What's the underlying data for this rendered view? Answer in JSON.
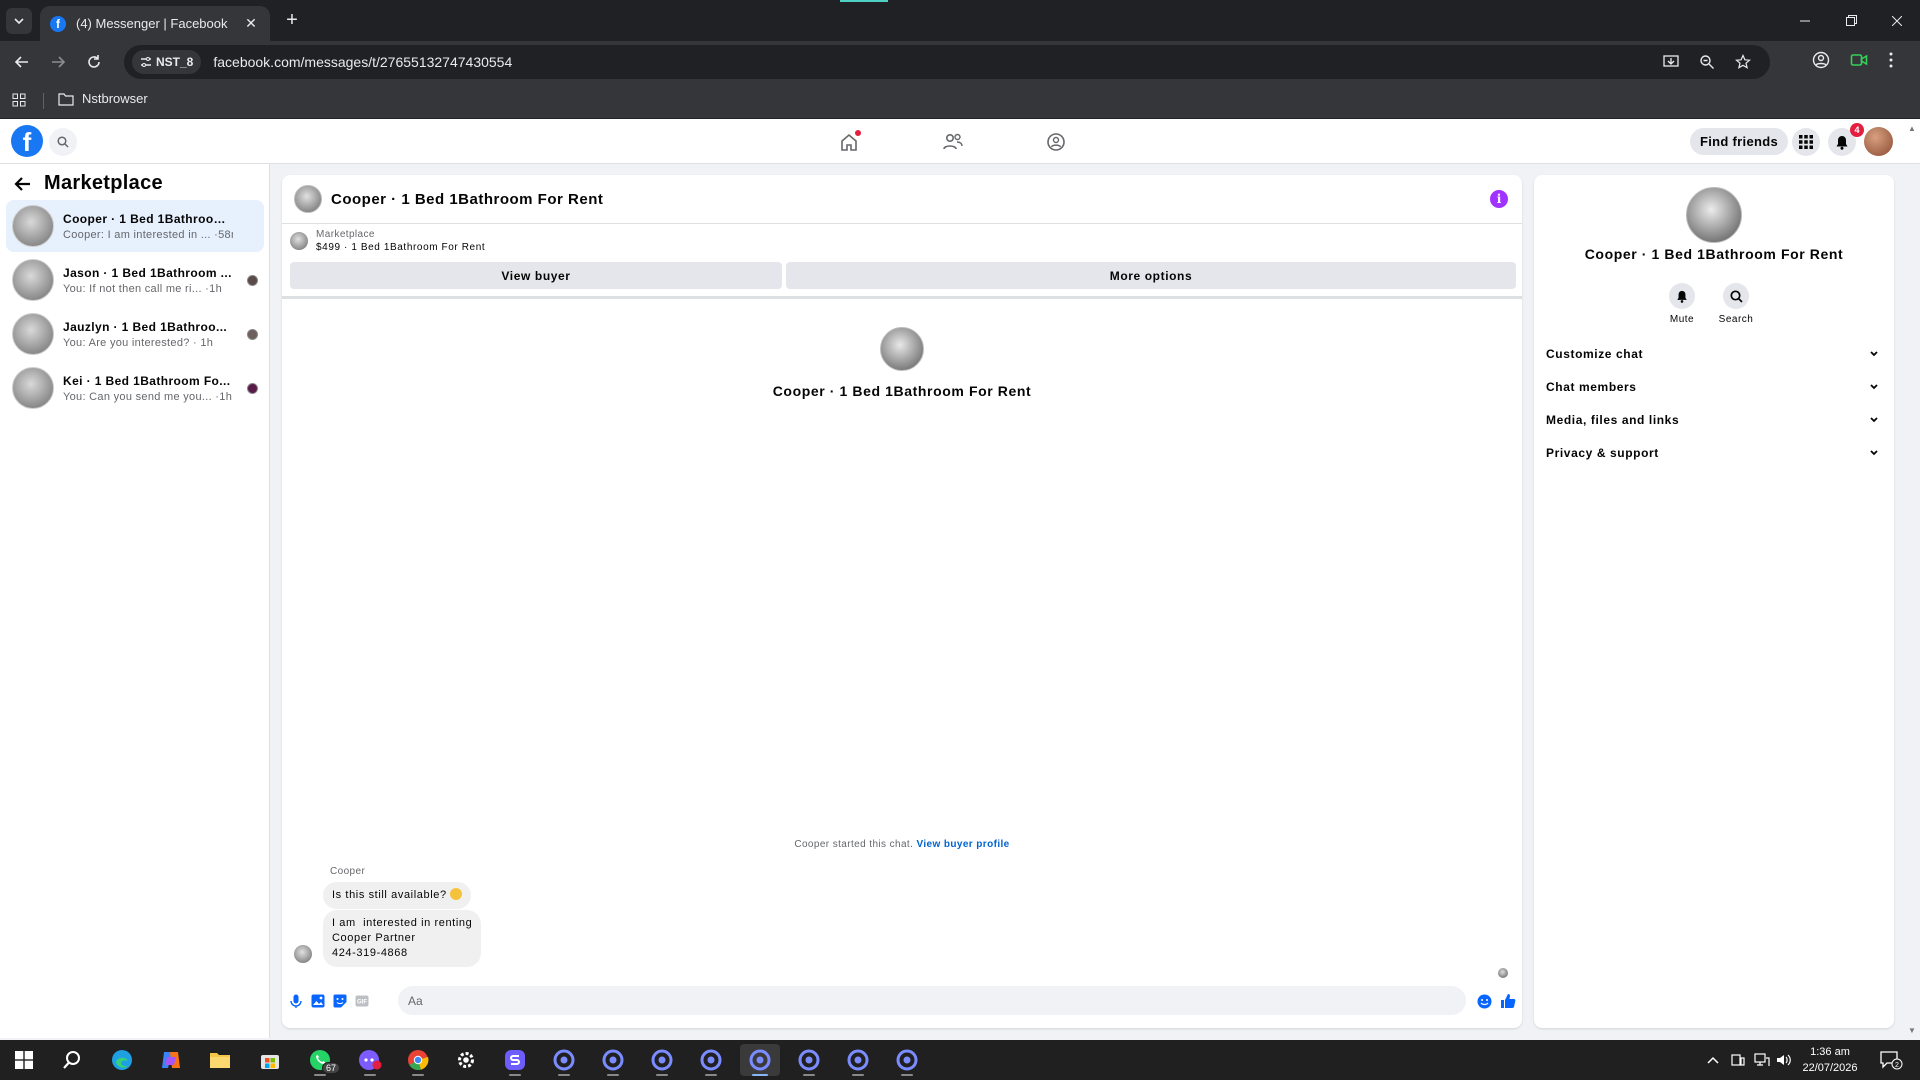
{
  "browser": {
    "tab_title": "(4) Messenger | Facebook",
    "profile_chip": "NST_8",
    "url": "facebook.com/messages/t/27655132747430554",
    "bookmark_folder": "Nstbrowser"
  },
  "header": {
    "find_friends": "Find friends",
    "notification_count": "4"
  },
  "sidebar": {
    "title": "Marketplace",
    "chats": [
      {
        "name": "Cooper · 1 Bed 1Bathroom ...",
        "preview": "Cooper: I am interested in ... ·58m"
      },
      {
        "name": "Jason · 1 Bed 1Bathroom ...",
        "preview": "You: If not then call me ri... ·1h"
      },
      {
        "name": "Jauzlyn · 1 Bed 1Bathroo...",
        "preview": "You: Are you interested? · 1h"
      },
      {
        "name": "Kei · 1 Bed 1Bathroom Fo...",
        "preview": "You: Can you send me you... ·1h"
      }
    ]
  },
  "chat": {
    "title": "Cooper · 1 Bed 1Bathroom For Rent",
    "marketplace_label": "Marketplace",
    "listing": "$499 · 1 Bed 1Bathroom For Rent",
    "view_buyer": "View buyer",
    "more_options": "More options",
    "hero_name": "Cooper · 1 Bed 1Bathroom For Rent",
    "started_text": "Cooper started this chat.",
    "view_buyer_profile": "View buyer profile",
    "sender": "Cooper",
    "message1": "Is this still available?",
    "message2_lines": [
      "I am  interested in renting",
      "Cooper Partner",
      "424-319-4868"
    ],
    "input_placeholder": "Aa"
  },
  "info": {
    "name": "Cooper · 1 Bed 1Bathroom For Rent",
    "mute": "Mute",
    "search": "Search",
    "sections": [
      "Customize chat",
      "Chat members",
      "Media, files and links",
      "Privacy & support"
    ]
  },
  "taskbar": {
    "whatsapp_badge": "67",
    "time": "1:36 am",
    "date": "22/07/2026",
    "notification_count": "2"
  },
  "colors": {
    "facebook_blue": "#1877f2",
    "info_purple": "#a033ff",
    "active_chat": "#e7f0fd"
  }
}
